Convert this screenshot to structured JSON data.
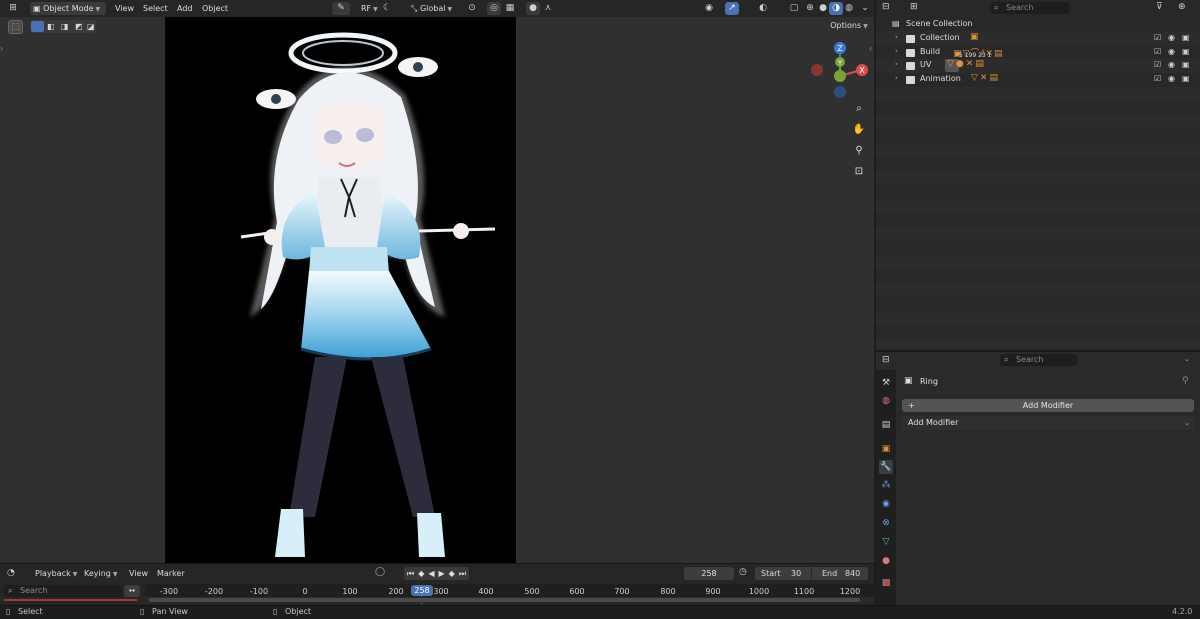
{
  "viewport": {
    "header": {
      "mode": "Object Mode",
      "menus": [
        "View",
        "Select",
        "Add",
        "Object"
      ],
      "pivot": "RF",
      "transform_orientation": "Global"
    },
    "options_label": "Options"
  },
  "timeline": {
    "menus": [
      "Playback",
      "Keying",
      "View",
      "Marker"
    ],
    "current_frame": "258",
    "start_label": "Start",
    "start_value": "30",
    "end_label": "End",
    "end_value": "840",
    "search_placeholder": "Search",
    "ticks": [
      "-300",
      "-200",
      "-100",
      "0",
      "100",
      "200",
      "300",
      "400",
      "500",
      "600",
      "700",
      "800",
      "900",
      "1000",
      "1100",
      "1200"
    ],
    "cursor_label": "258"
  },
  "outliner": {
    "search_placeholder": "Search",
    "scene_collection": "Scene Collection",
    "items": [
      {
        "label": "Collection"
      },
      {
        "label": "Build",
        "badge": "5 199 23 1"
      },
      {
        "label": "UV"
      },
      {
        "label": "Animation"
      }
    ]
  },
  "properties": {
    "search_placeholder": "Search",
    "object_name": "Ring",
    "add_modifier_button": "Add Modifier",
    "add_modifier_panel": "Add Modifier"
  },
  "statusbar": {
    "select": "Select",
    "pan_view": "Pan View",
    "object": "Object",
    "version": "4.2.0"
  },
  "colors": {
    "accent": "#4772b3",
    "axis_x": "#d84c4c",
    "axis_y": "#7ea23a",
    "axis_z": "#3b79d6",
    "object_orange": "#e0903a"
  }
}
